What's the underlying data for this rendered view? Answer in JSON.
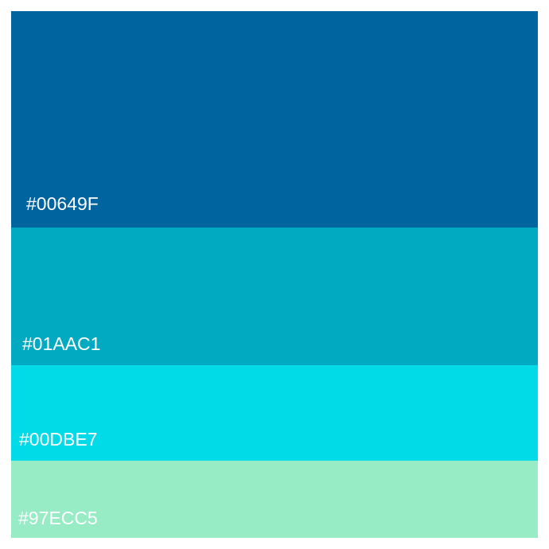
{
  "swatches": [
    {
      "label": "#00649F",
      "color": "#00649F"
    },
    {
      "label": "#01AAC1",
      "color": "#01AAC1"
    },
    {
      "label": "#00DBE7",
      "color": "#00DBE7"
    },
    {
      "label": "#97ECC5",
      "color": "#97ECC5"
    }
  ]
}
